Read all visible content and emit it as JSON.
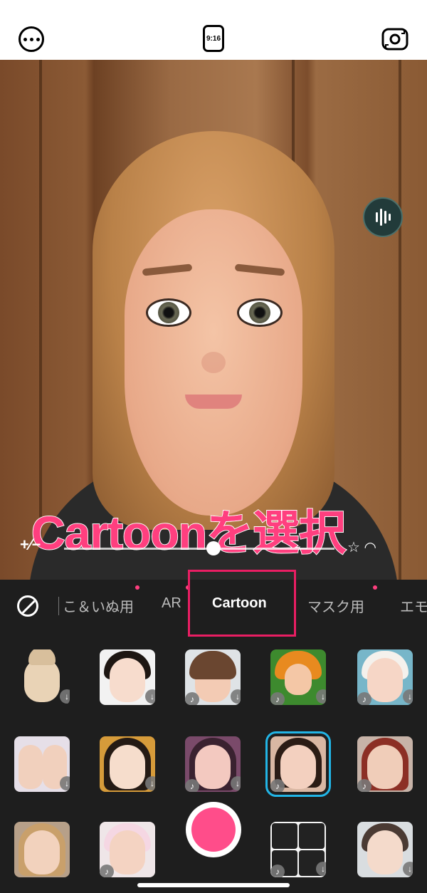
{
  "topbar": {
    "more_icon": "ellipsis-circle-icon",
    "ratio_label": "9:16",
    "flip_icon": "camera-flip-icon"
  },
  "camera": {
    "voice_icon": "voice-changer-icon"
  },
  "overlay": {
    "caption": "Cartoonを選択"
  },
  "tabs": {
    "none_icon": "no-effect-icon",
    "items": [
      {
        "label": "こ＆いぬ用"
      },
      {
        "label": "AR"
      },
      {
        "label": "Cartoon"
      },
      {
        "label": "マスク用"
      },
      {
        "label": "エモ"
      }
    ],
    "active": "Cartoon"
  },
  "effects": {
    "rows": [
      [
        "bunny-costume",
        "red-cheek-girl",
        "bowl-cut-kid",
        "tiger-costume",
        "bonnet-baby"
      ],
      [
        "couple",
        "long-hair-girl",
        "glam-girl",
        "brown-hair-girl",
        "red-hair-girl"
      ],
      [
        "blonde-girl",
        "cow-hood-kid",
        "",
        "grid-portrait",
        "light-girl"
      ]
    ],
    "selected": "brown-hair-girl"
  },
  "colors": {
    "accent": "#ff3f7f",
    "highlight_box": "#e91e63",
    "selection_outline": "#22b5e6",
    "panel_bg": "#1e1e1e",
    "record": "#ff4d8a"
  }
}
